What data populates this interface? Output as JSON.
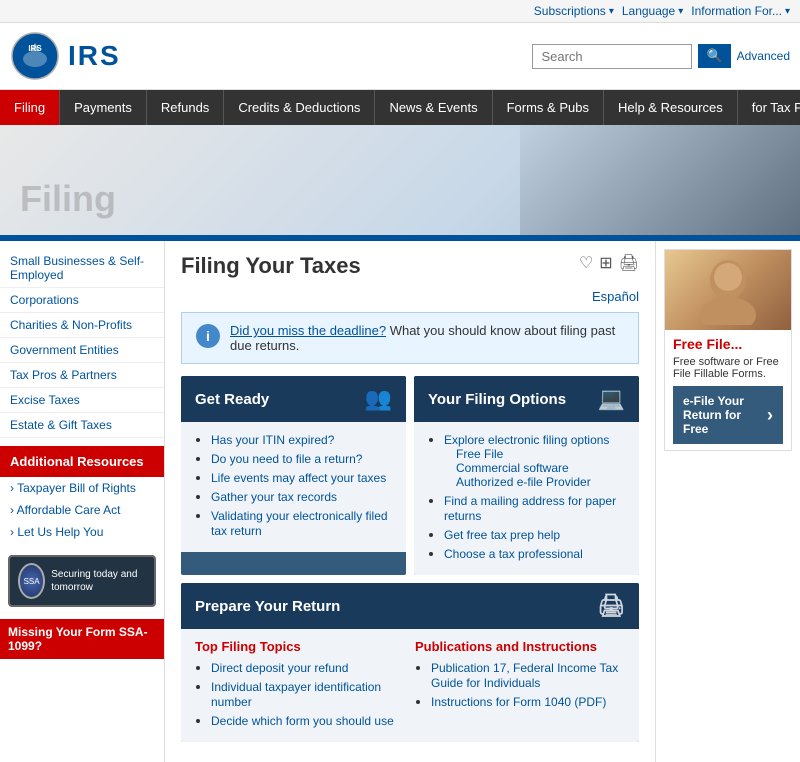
{
  "topbar": {
    "items": [
      "Subscriptions",
      "Language",
      "Information For..."
    ],
    "advanced": "Advanced"
  },
  "header": {
    "logo_text": "IRS",
    "search_placeholder": "Search",
    "search_label": "Search"
  },
  "nav": {
    "items": [
      {
        "label": "Filing",
        "active": true
      },
      {
        "label": "Payments",
        "active": false
      },
      {
        "label": "Refunds",
        "active": false
      },
      {
        "label": "Credits & Deductions",
        "active": false
      },
      {
        "label": "News & Events",
        "active": false
      },
      {
        "label": "Forms & Pubs",
        "active": false
      },
      {
        "label": "Help & Resources",
        "active": false
      },
      {
        "label": "for Tax Pros",
        "active": false
      }
    ]
  },
  "hero": {
    "title": "Filing"
  },
  "sidebar": {
    "links": [
      "Small Businesses & Self-Employed",
      "Corporations",
      "Charities & Non-Profits",
      "Government Entities",
      "Tax Pros & Partners",
      "Excise Taxes",
      "Estate & Gift Taxes"
    ],
    "additional_resources_label": "Additional Resources",
    "resources": [
      "Taxpayer Bill of Rights",
      "Affordable Care Act",
      "Let Us Help You"
    ],
    "badge_text": "Securing today and tomorrow",
    "missing_form": "Missing Your Form SSA-1099?"
  },
  "content": {
    "page_title": "Filing Your Taxes",
    "espanol": "Español",
    "info_box": {
      "link_text": "Did you miss the deadline?",
      "text": " What you should know about filing past due returns."
    },
    "get_ready": {
      "title": "Get Ready",
      "links": [
        "Has your ITIN expired?",
        "Do you need to file a return?",
        "Life events may affect your taxes",
        "Gather your tax records",
        "Validating your electronically filed tax return"
      ]
    },
    "filing_options": {
      "title": "Your Filing Options",
      "links": [
        "Explore electronic filing options",
        "Free File",
        "Commercial software",
        "Authorized e-file Provider",
        "Find a mailing address for paper returns",
        "Get free tax prep help",
        "Choose a tax professional"
      ]
    },
    "prepare_return": {
      "title": "Prepare Your Return",
      "top_filing": {
        "title": "Top Filing Topics",
        "links": [
          "Direct deposit your refund",
          "Individual taxpayer identification number",
          "Decide which form you should use"
        ]
      },
      "publications": {
        "title": "Publications and Instructions",
        "links": [
          "Publication 17, Federal Income Tax Guide for Individuals",
          "Instructions for Form 1040 (PDF)"
        ]
      }
    }
  },
  "right_sidebar": {
    "free_file_title": "Free File...",
    "free_file_text": "Free software or Free File Fillable Forms.",
    "efile_btn": "e-File Your Return for Free"
  }
}
